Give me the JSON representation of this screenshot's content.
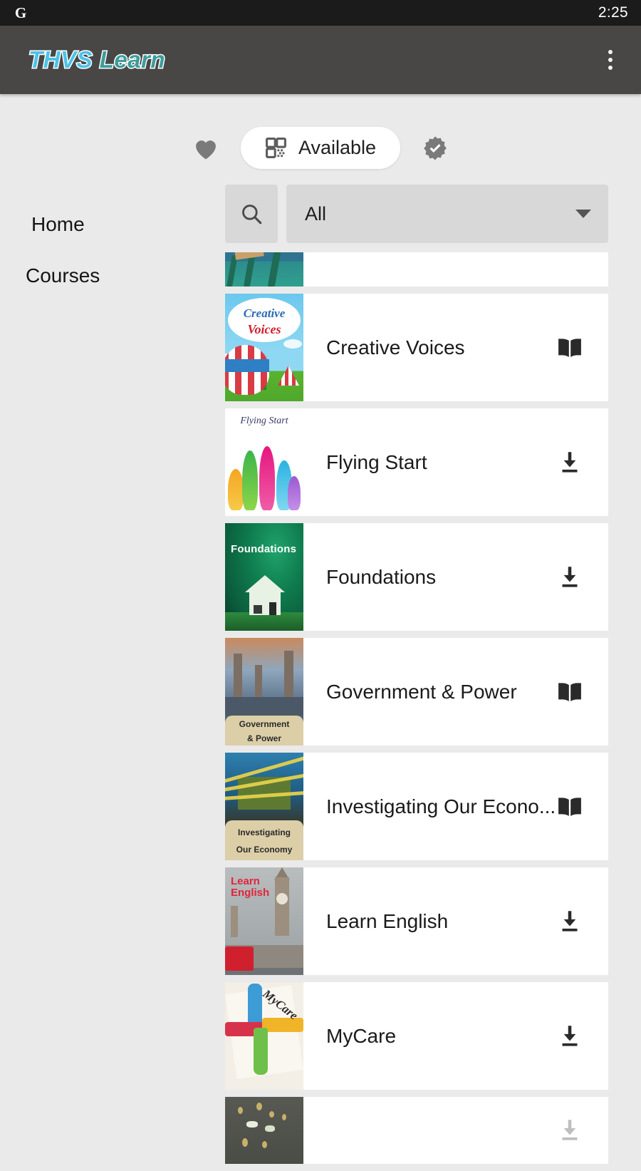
{
  "status_bar": {
    "app_icon": "google-g-icon",
    "time": "2:25"
  },
  "app_bar": {
    "brand_part1": "THVS",
    "brand_part2": "Learn",
    "menu_icon": "overflow-menu-icon"
  },
  "filter_toggle": {
    "favorites_icon": "heart-icon",
    "available_icon": "qr-code-icon",
    "available_label": "Available",
    "verified_icon": "verified-badge-icon",
    "selected": "Available"
  },
  "search": {
    "search_icon": "search-icon",
    "dropdown_value": "All",
    "dropdown_caret_icon": "chevron-down-icon"
  },
  "sidebar": {
    "items": [
      {
        "label": "Home",
        "active": false
      },
      {
        "label": "Courses",
        "active": true
      }
    ]
  },
  "courses": [
    {
      "title": "",
      "action_icon": "",
      "thumb": "water-ski",
      "clipped": "top"
    },
    {
      "title": "Creative Voices",
      "action_icon": "open-book-icon",
      "thumb": "creative-voices",
      "thumb_text_1": "Creative",
      "thumb_text_2": "Voices"
    },
    {
      "title": "Flying Start",
      "action_icon": "download-icon",
      "thumb": "flying-start",
      "thumb_text_1": "Flying Start"
    },
    {
      "title": "Foundations",
      "action_icon": "download-icon",
      "thumb": "foundations",
      "thumb_text_1": "Foundations"
    },
    {
      "title": "Government & Power",
      "action_icon": "open-book-icon",
      "thumb": "government-power",
      "thumb_text_1": "Government",
      "thumb_text_2": "& Power"
    },
    {
      "title": "Investigating Our Econo...",
      "action_icon": "open-book-icon",
      "thumb": "investigating-economy",
      "thumb_text_1": "Investigating",
      "thumb_text_2": "Our Economy"
    },
    {
      "title": "Learn English",
      "action_icon": "download-icon",
      "thumb": "learn-english",
      "thumb_text_1": "Learn",
      "thumb_text_2": "English"
    },
    {
      "title": "MyCare",
      "action_icon": "download-icon",
      "thumb": "mycare",
      "thumb_text_1": "MyCare"
    },
    {
      "title": "",
      "action_icon": "download-icon",
      "thumb": "seeds",
      "clipped": "bottom"
    }
  ],
  "colors": {
    "status_bar_bg": "#1B1B1B",
    "app_bar_bg": "#494745",
    "page_bg": "#EAEAEA",
    "card_bg": "#FFFFFF",
    "brand_blue": "#4CC3E8",
    "brand_teal": "#3E9C9C",
    "control_gray": "#D8D8D8",
    "icon_gray": "#7A7A7A",
    "active_indicator": "#4A4745"
  }
}
